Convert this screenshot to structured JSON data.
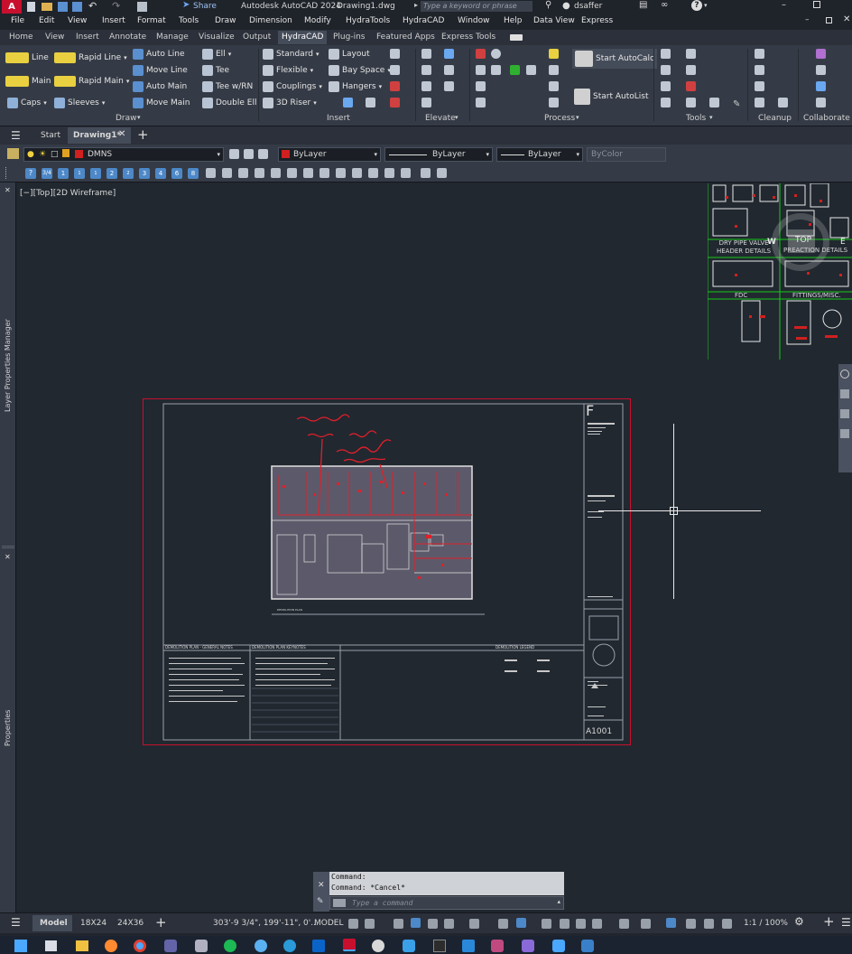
{
  "titlebar": {
    "app_letter": "A",
    "share_label": "Share",
    "app_title": "Autodesk AutoCAD 2024",
    "file_name": "Drawing1.dwg",
    "search_placeholder": "Type a keyword or phrase",
    "user": "dsaffer"
  },
  "menu": [
    "File",
    "Edit",
    "View",
    "Insert",
    "Format",
    "Tools",
    "Draw",
    "Dimension",
    "Modify",
    "HydraTools",
    "HydraCAD",
    "Window",
    "Help",
    "Data View",
    "Express"
  ],
  "ribbon_tabs": [
    "Home",
    "View",
    "Insert",
    "Annotate",
    "Manage",
    "Visualize",
    "Output",
    "HydraCAD",
    "Plug-ins",
    "Featured Apps",
    "Express Tools"
  ],
  "ribbon_active_tab": "HydraCAD",
  "ribbon": {
    "draw": {
      "title": "Draw",
      "line": "Line",
      "rapid_line": "Rapid Line",
      "main": "Main",
      "rapid_main": "Rapid Main",
      "caps": "Caps",
      "sleeves": "Sleeves",
      "auto_line": "Auto Line",
      "move_line": "Move Line",
      "auto_main": "Auto Main",
      "move_main": "Move Main",
      "ell": "Ell",
      "tee": "Tee",
      "tee_wrn": "Tee w/RN",
      "double_ell": "Double Ell"
    },
    "insert": {
      "title": "Insert",
      "standard": "Standard",
      "flexible": "Flexible",
      "couplings": "Couplings",
      "riser_3d": "3D Riser",
      "layout": "Layout",
      "bay_space": "Bay Space",
      "hangers": "Hangers"
    },
    "elevate": {
      "title": "Elevate"
    },
    "process": {
      "title": "Process",
      "start_autocalc": "Start AutoCalc",
      "start_autolist": "Start AutoList"
    },
    "tools": {
      "title": "Tools"
    },
    "cleanup": {
      "title": "Cleanup"
    },
    "collaborate": {
      "title": "Collaborate"
    }
  },
  "file_tabs": {
    "start": "Start",
    "drawing": "Drawing1*"
  },
  "layer_bar": {
    "layer_name": "DMNS",
    "color": "ByLayer",
    "linetype": "ByLayer",
    "lineweight": "ByLayer",
    "plotstyle": "ByColor"
  },
  "dim_toolbar_labels": [
    "?",
    "3/4",
    "1",
    "1 1/4",
    "1 1/2",
    "2",
    "2 1/2",
    "3",
    "4",
    "6",
    "8"
  ],
  "viewport_label": "[−][Top][2D Wireframe]",
  "palettes": {
    "layer_manager": "Layer Properties Manager",
    "properties": "Properties"
  },
  "detail_sheets": {
    "dry_pipe": "DRY PIPE VALVE\nHEADER DETAILS",
    "preaction": "PREACTION DETAILS",
    "fdc": "FDC",
    "fittings": "FITTINGS/MISC.",
    "viewcube": "TOP",
    "compass_w": "W",
    "compass_e": "E"
  },
  "sheet": {
    "number": "A1001",
    "plan_title": "DEMOLITION PLAN",
    "general_notes": "DEMOLITION PLAN - GENERAL NOTES",
    "keynotes": "DEMOLITION PLAN KEYNOTES",
    "legend": "DEMOLITION LEGEND",
    "logo": "F"
  },
  "command": {
    "line1": "Command:",
    "line2": "Command: *Cancel*",
    "placeholder": "Type a command"
  },
  "status": {
    "tabs": [
      "Model",
      "18X24",
      "24X36"
    ],
    "coords": "303'-9 3/4\", 199'-11\", 0'...",
    "model": "MODEL",
    "scale": "1:1 / 100%"
  },
  "colors": {
    "accent_red": "#d0201f",
    "sheet_border": "#c8102e",
    "detail_green": "#18c818",
    "canvas": "#212830",
    "ribbon": "#353b46"
  }
}
